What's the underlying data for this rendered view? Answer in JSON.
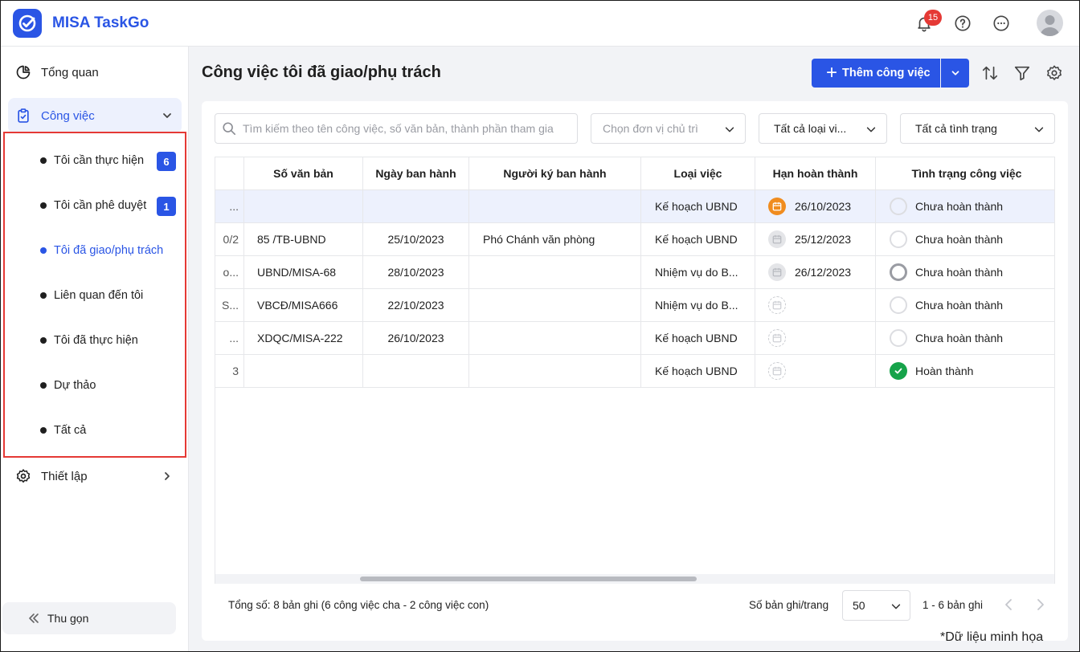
{
  "app": {
    "title": "MISA TaskGo",
    "notification_count": "15",
    "brand_color": "#2a55e5"
  },
  "sidebar": {
    "overview": "Tổng quan",
    "tasks": "Công việc",
    "sub_items": [
      {
        "label": "Tôi cần thực hiện",
        "count": "6"
      },
      {
        "label": "Tôi cần phê duyệt",
        "count": "1"
      },
      {
        "label": "Tôi đã giao/phụ trách",
        "count": null
      },
      {
        "label": "Liên quan đến tôi",
        "count": null
      },
      {
        "label": "Tôi đã thực hiện",
        "count": null
      },
      {
        "label": "Dự thảo",
        "count": null
      },
      {
        "label": "Tất cả",
        "count": null
      }
    ],
    "settings": "Thiết lập",
    "collapse": "Thu gọn"
  },
  "main": {
    "title": "Công việc tôi đã giao/phụ trách",
    "add_button": "Thêm công việc"
  },
  "filters": {
    "search_placeholder": "Tìm kiếm theo tên công việc, số văn bản, thành phần tham gia",
    "unit_placeholder": "Chọn đơn vị chủ trì",
    "type": "Tất cả loại vi...",
    "status": "Tất cả tình trạng"
  },
  "table": {
    "headers": [
      "Số văn bản",
      "Ngày ban hành",
      "Người ký ban hành",
      "Loại việc",
      "Hạn hoàn thành",
      "Tình trạng công việc"
    ],
    "rows": [
      {
        "clip": "...",
        "doc": "",
        "date": "",
        "signer": "",
        "type": "Kế hoạch UBND",
        "deadline": "26/10/2023",
        "cal": "orange",
        "status": "Chưa hoàn thành",
        "status_icon": "light"
      },
      {
        "clip": "0/2",
        "doc": "85 /TB-UBND",
        "date": "25/10/2023",
        "signer": "Phó Chánh văn phòng",
        "type": "Kế hoạch UBND",
        "deadline": "25/12/2023",
        "cal": "gray",
        "status": "Chưa hoàn thành",
        "status_icon": "light"
      },
      {
        "clip": "o...",
        "doc": "UBND/MISA-68",
        "date": "28/10/2023",
        "signer": "",
        "type": "Nhiệm vụ do B...",
        "deadline": "26/12/2023",
        "cal": "gray",
        "status": "Chưa hoàn thành",
        "status_icon": "dark"
      },
      {
        "clip": "S...",
        "doc": "VBCĐ/MISA666",
        "date": "22/10/2023",
        "signer": "",
        "type": "Nhiệm vụ do B...",
        "deadline": "",
        "cal": "dash",
        "status": "Chưa hoàn thành",
        "status_icon": "light"
      },
      {
        "clip": "...",
        "doc": "XDQC/MISA-222",
        "date": "26/10/2023",
        "signer": "",
        "type": "Kế hoạch UBND",
        "deadline": "",
        "cal": "dash",
        "status": "Chưa hoàn thành",
        "status_icon": "light"
      },
      {
        "clip": "3",
        "doc": "",
        "date": "",
        "signer": "",
        "type": "Kế hoạch UBND",
        "deadline": "",
        "cal": "dash",
        "status": "Hoàn thành",
        "status_icon": "done"
      }
    ]
  },
  "footer": {
    "total": "Tổng số: 8 bản ghi (6 công việc cha - 2 công việc con)",
    "per_page_label": "Số bản ghi/trang",
    "per_page": "50",
    "range": "1 - 6 bản ghi"
  },
  "note": "*Dữ liệu minh họa"
}
